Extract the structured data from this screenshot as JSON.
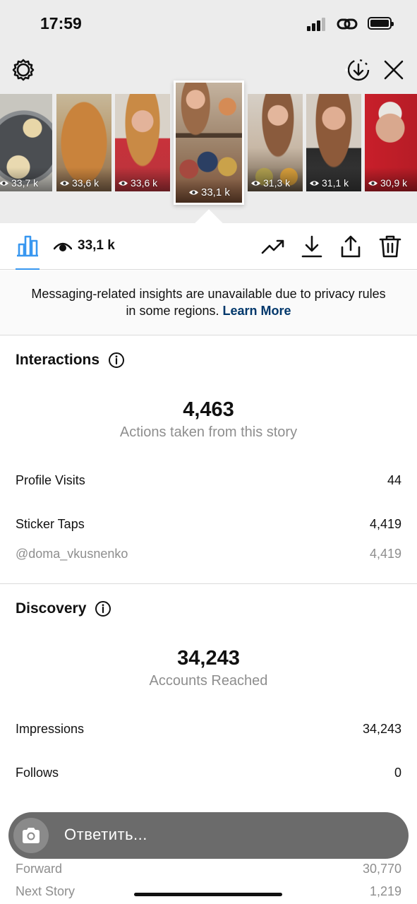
{
  "status_bar": {
    "time": "17:59"
  },
  "story_strip": {
    "thumbnails": [
      {
        "views": "33,7 k"
      },
      {
        "views": "33,6 k"
      },
      {
        "views": "33,6 k"
      },
      {
        "views": "33,1 k"
      },
      {
        "views": "31,3 k"
      },
      {
        "views": "31,1 k"
      },
      {
        "views": "30,9 k"
      }
    ]
  },
  "toolbar": {
    "view_count": "33,1 k"
  },
  "notice": {
    "text": "Messaging-related insights are unavailable due to privacy rules in some regions.",
    "link": "Learn More"
  },
  "interactions": {
    "title": "Interactions",
    "total": "4,463",
    "total_label": "Actions taken from this story",
    "rows": [
      {
        "label": "Profile Visits",
        "value": "44"
      },
      {
        "label": "Sticker Taps",
        "value": "4,419"
      },
      {
        "label": "@doma_vkusnenko",
        "value": "4,419"
      }
    ]
  },
  "discovery": {
    "title": "Discovery",
    "total": "34,243",
    "total_label": "Accounts Reached",
    "rows": [
      {
        "label": "Impressions",
        "value": "34,243"
      },
      {
        "label": "Follows",
        "value": "0"
      },
      {
        "label": "Forward",
        "value": "30,770"
      },
      {
        "label": "Next Story",
        "value": "1,219"
      }
    ]
  },
  "reply": {
    "placeholder": "Ответить..."
  },
  "colors": {
    "accent": "#3897f0",
    "link": "#00376b",
    "muted": "#8e8e8e"
  },
  "icons": [
    "settings-gear-icon",
    "download-story-icon",
    "close-icon",
    "insights-chart-icon",
    "eye-icon",
    "trending-icon",
    "download-icon",
    "share-icon",
    "trash-icon",
    "info-icon",
    "camera-icon"
  ]
}
